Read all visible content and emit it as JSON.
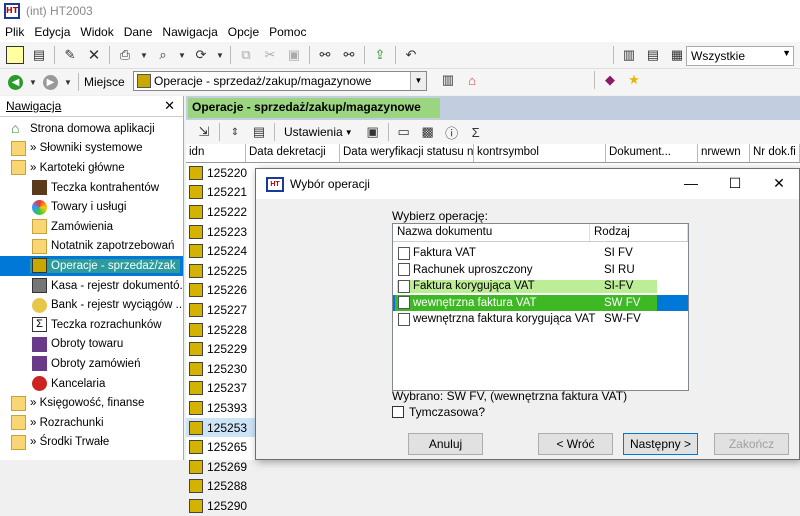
{
  "window": {
    "title": "(int)  HT2003",
    "logo_text": "HT"
  },
  "menu": [
    "Plik",
    "Edycja",
    "Widok",
    "Dane",
    "Nawigacja",
    "Opcje",
    "Pomoc"
  ],
  "toolbar": {
    "filter_value": "Wszystkie"
  },
  "location": {
    "label": "Miejsce",
    "value": "Operacje - sprzedaż/zakup/magazynowe"
  },
  "nav": {
    "title": "Nawigacja",
    "items": [
      {
        "label": "Strona domowa aplikacji",
        "level": 0
      },
      {
        "label": "» Słowniki systemowe",
        "level": 0
      },
      {
        "label": "» Kartoteki główne",
        "level": 0
      },
      {
        "label": "Teczka kontrahentów",
        "level": 1
      },
      {
        "label": "Towary i usługi",
        "level": 1
      },
      {
        "label": "Zamówienia",
        "level": 1
      },
      {
        "label": "Notatnik zapotrzebowań",
        "level": 1
      },
      {
        "label": "Operacje - sprzedaż/zak",
        "level": 1,
        "selected": true
      },
      {
        "label": "Kasa - rejestr dokumentó...",
        "level": 1
      },
      {
        "label": "Bank - rejestr wyciągów ...",
        "level": 1
      },
      {
        "label": "Teczka rozrachunków",
        "level": 1
      },
      {
        "label": "Obroty towaru",
        "level": 1
      },
      {
        "label": "Obroty zamówień",
        "level": 1
      },
      {
        "label": "Kancelaria",
        "level": 1
      },
      {
        "label": "» Księgowość, finanse",
        "level": 0
      },
      {
        "label": "» Rozrachunki",
        "level": 0
      },
      {
        "label": "» Środki Trwałe",
        "level": 0
      }
    ]
  },
  "content": {
    "title": "Operacje - sprzedaż/zakup/magazynowe",
    "settings_label": "Ustawienia",
    "columns": [
      "idn",
      "Data dekretacji",
      "Data weryfikacji statusu nip",
      "kontrsymbol",
      "Dokument...",
      "nrwewn",
      "Nr dok.fi"
    ],
    "rows": [
      "125220",
      "125221",
      "125222",
      "125223",
      "125224",
      "125225",
      "125226",
      "125227",
      "125228",
      "125229",
      "125230",
      "125237",
      "125393",
      "125253",
      "125265",
      "125269",
      "125288",
      "125290"
    ]
  },
  "dialog": {
    "title": "Wybór operacji",
    "prompt": "Wybierz operację:",
    "columns": [
      "Nazwa dokumentu",
      "Rodzaj"
    ],
    "items": [
      {
        "name": "Faktura VAT",
        "kind": "SI FV"
      },
      {
        "name": "Rachunek uproszczony",
        "kind": "SI RU"
      },
      {
        "name": "Faktura korygująca VAT",
        "kind": "SI-FV"
      },
      {
        "name": "wewnętrzna faktura VAT",
        "kind": "SW FV",
        "selected": true
      },
      {
        "name": "wewnętrzna faktura korygująca VAT",
        "kind": "SW-FV"
      }
    ],
    "selected_text": "Wybrano: SW FV, (wewnętrzna faktura VAT)",
    "temporary_label": "Tymczasowa?",
    "buttons": {
      "cancel": "Anuluj",
      "back": "< Wróć",
      "next": "Następny >",
      "finish": "Zakończ"
    }
  }
}
